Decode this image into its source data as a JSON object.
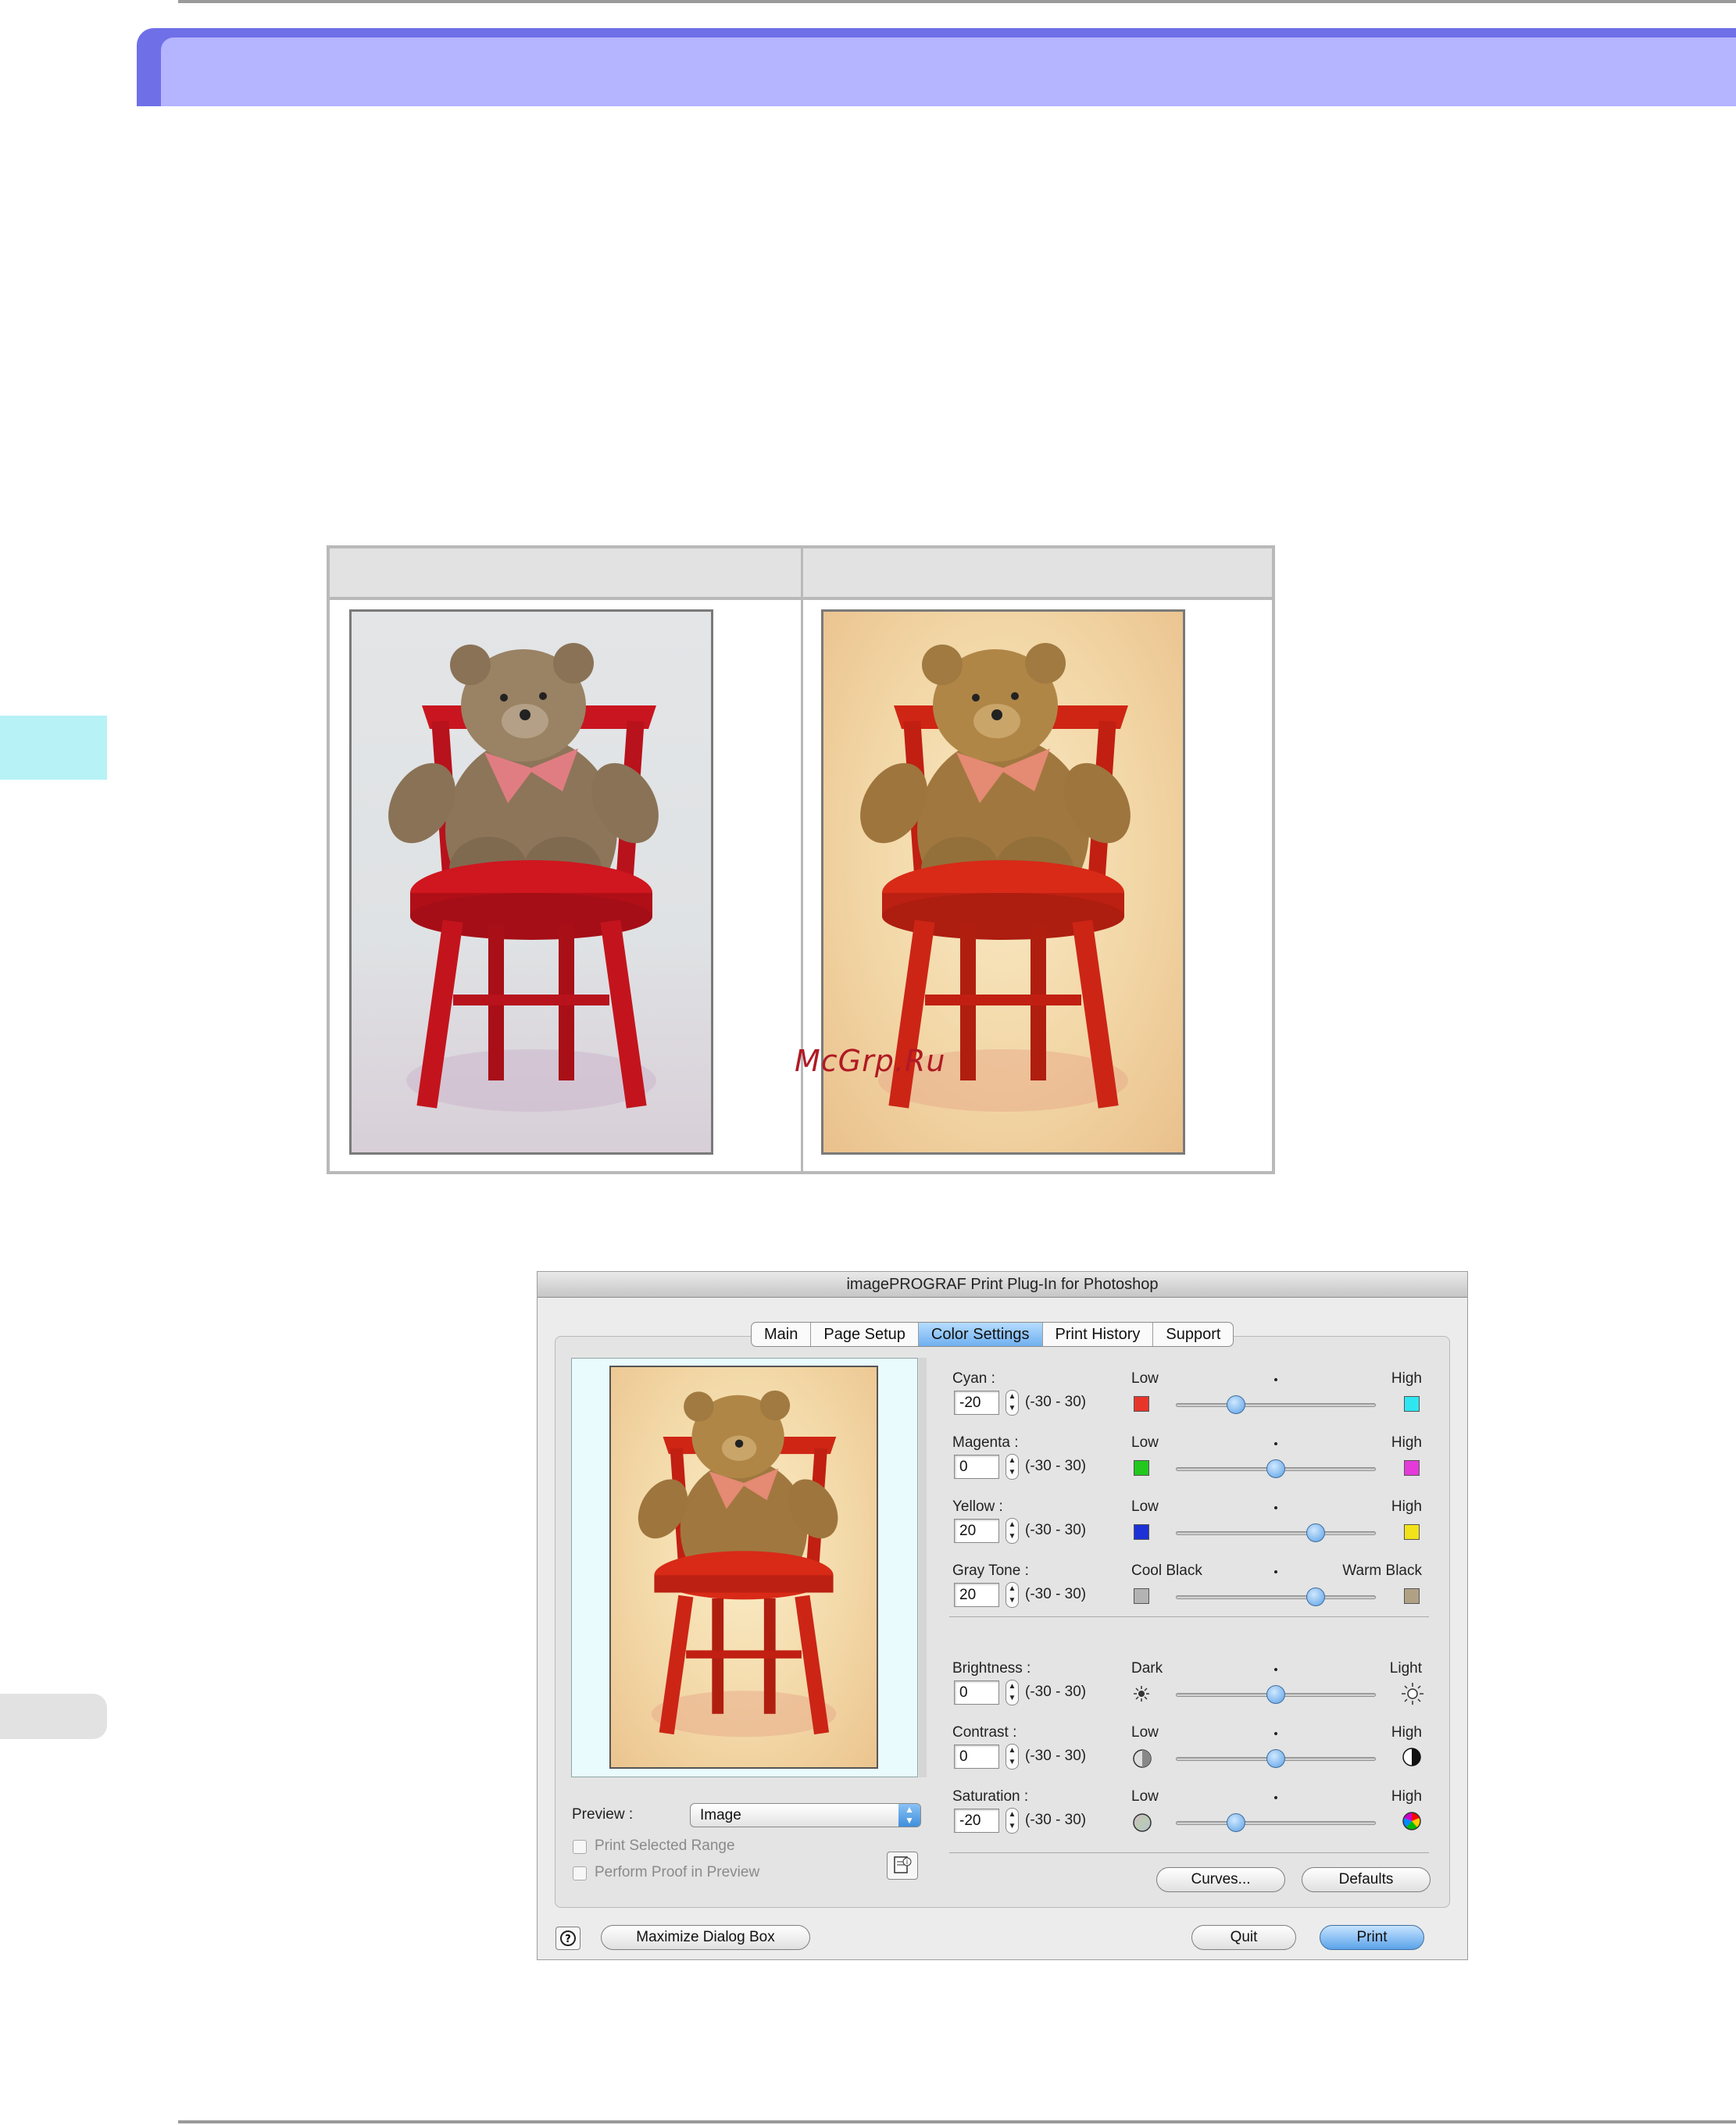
{
  "page": {
    "watermark": "McGrp.Ru"
  },
  "colors": {
    "banner_dark": "#6f6fe8",
    "banner_light": "#b4b4ff",
    "side_tab_cyan": "#b7f2f6",
    "watermark": "#b01a24",
    "tab_active": "#6fb0ef"
  },
  "comparison": {
    "photos": [
      {
        "name": "teddy-bear-original",
        "tone": "neutral cool background"
      },
      {
        "name": "teddy-bear-adjusted",
        "tone": "warm yellow background"
      }
    ]
  },
  "dialog": {
    "title": "imagePROGRAF Print Plug-In for Photoshop",
    "tabs": [
      {
        "label": "Main",
        "active": false
      },
      {
        "label": "Page Setup",
        "active": false
      },
      {
        "label": "Color Settings",
        "active": true
      },
      {
        "label": "Print History",
        "active": false
      },
      {
        "label": "Support",
        "active": false
      }
    ],
    "preview": {
      "label": "Preview :",
      "selected": "Image",
      "print_selected_range": "Print Selected Range",
      "perform_proof": "Perform Proof in Preview"
    },
    "color_rows": [
      {
        "label": "Cyan :",
        "value": "-20",
        "range": "(-30 - 30)",
        "low": "Low",
        "high": "High",
        "low_color": "#e8352a",
        "high_color": "#2fe6f0",
        "level": -20,
        "min": -30,
        "max": 30
      },
      {
        "label": "Magenta :",
        "value": "0",
        "range": "(-30 - 30)",
        "low": "Low",
        "high": "High",
        "low_color": "#22c81e",
        "high_color": "#e33ad9",
        "level": 0,
        "min": -30,
        "max": 30
      },
      {
        "label": "Yellow :",
        "value": "20",
        "range": "(-30 - 30)",
        "low": "Low",
        "high": "High",
        "low_color": "#1c31d6",
        "high_color": "#f2e21a",
        "level": 20,
        "min": -30,
        "max": 30
      },
      {
        "label": "Gray Tone :",
        "value": "20",
        "range": "(-30 - 30)",
        "low": "Cool Black",
        "high": "Warm Black",
        "low_color": "#b3b3b3",
        "high_color": "#b1a184",
        "level": 20,
        "min": -30,
        "max": 30
      }
    ],
    "tone_rows": [
      {
        "label": "Brightness :",
        "value": "0",
        "range": "(-30 - 30)",
        "low": "Dark",
        "high": "Light",
        "low_icon": "sun-dark-icon",
        "high_icon": "sun-light-icon",
        "level": 0,
        "min": -30,
        "max": 30
      },
      {
        "label": "Contrast :",
        "value": "0",
        "range": "(-30 - 30)",
        "low": "Low",
        "high": "High",
        "low_icon": "contrast-low-icon",
        "high_icon": "contrast-high-icon",
        "level": 0,
        "min": -30,
        "max": 30
      },
      {
        "label": "Saturation :",
        "value": "-20",
        "range": "(-30 - 30)",
        "low": "Low",
        "high": "High",
        "low_icon": "saturation-low-icon",
        "high_icon": "saturation-high-icon",
        "level": -20,
        "min": -30,
        "max": 30
      }
    ],
    "buttons": {
      "curves": "Curves...",
      "defaults": "Defaults",
      "maximize": "Maximize Dialog Box",
      "quit": "Quit",
      "print": "Print"
    }
  }
}
